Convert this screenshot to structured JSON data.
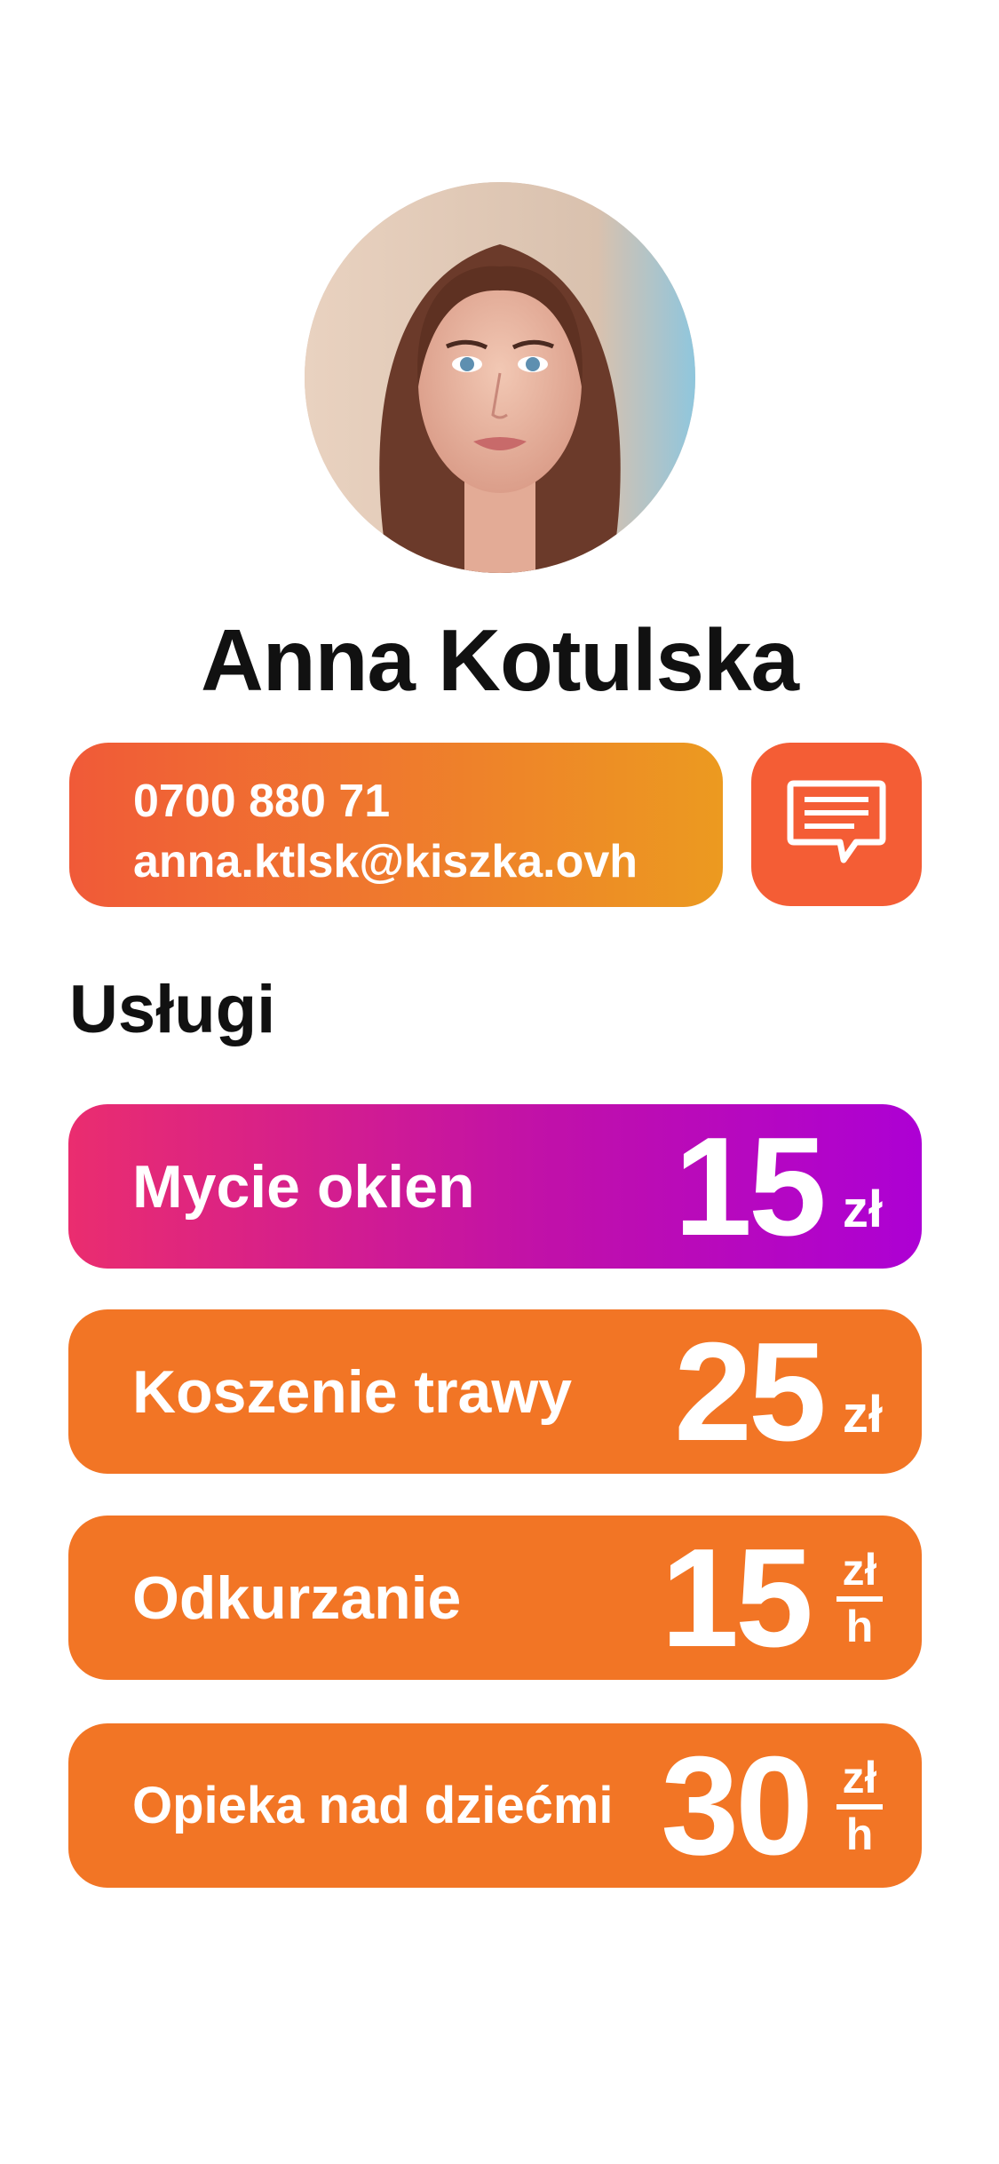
{
  "profile": {
    "name": "Anna Kotulska",
    "phone": "0700 880 71",
    "email": "anna.ktlsk@kiszka.ovh"
  },
  "chat": {
    "icon": "chat-bubble-icon"
  },
  "services_title": "Usługi",
  "colors": {
    "accent": "#f27525",
    "featured_start": "#ea2d6f",
    "featured_end": "#ad00d4",
    "chat_button": "#f45d35"
  },
  "services": [
    {
      "label": "Mycie okien",
      "amount": "15",
      "unit": "zł",
      "per": ""
    },
    {
      "label": "Koszenie trawy",
      "amount": "25",
      "unit": "zł",
      "per": ""
    },
    {
      "label": "Odkurzanie",
      "amount": "15",
      "unit": "zł",
      "per": "h"
    },
    {
      "label": "Opieka nad dziećmi",
      "amount": "30",
      "unit": "zł",
      "per": "h"
    }
  ]
}
